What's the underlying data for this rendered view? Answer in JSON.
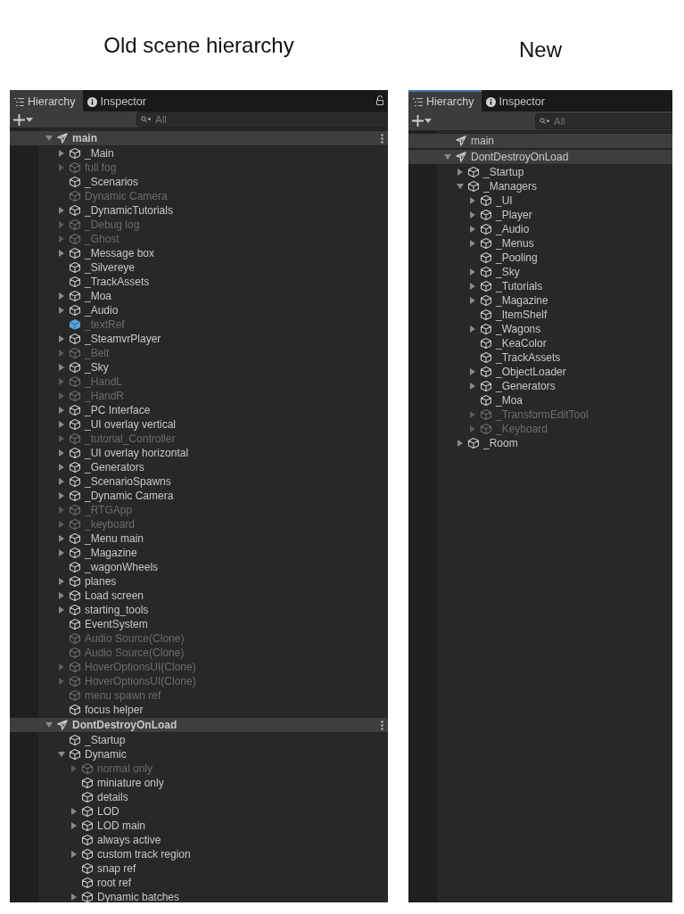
{
  "panels": [
    {
      "caption": "Old scene hierarchy",
      "focused": false,
      "show_lock": true,
      "tabs": [
        {
          "label": "Hierarchy",
          "kind": "hierarchy",
          "selected": true
        },
        {
          "label": "Inspector",
          "kind": "inspector",
          "selected": false
        }
      ],
      "search": {
        "placeholder": "All"
      },
      "scenes": [
        {
          "name": "main",
          "has_children": true,
          "expanded": true,
          "menu": true,
          "children": [
            {
              "name": "_Main",
              "kind": "object",
              "active": true,
              "has_children": true,
              "expanded": false
            },
            {
              "name": "full fog",
              "kind": "object",
              "active": false,
              "has_children": true,
              "expanded": false
            },
            {
              "name": "_Scenarios",
              "kind": "object",
              "active": true,
              "has_children": false
            },
            {
              "name": "Dynamic Camera",
              "kind": "object",
              "active": false,
              "has_children": false
            },
            {
              "name": "_DynamicTutorials",
              "kind": "object",
              "active": true,
              "has_children": true,
              "expanded": false
            },
            {
              "name": "_Debug log",
              "kind": "object",
              "active": false,
              "has_children": true,
              "expanded": false
            },
            {
              "name": "_Ghost",
              "kind": "object",
              "active": false,
              "has_children": true,
              "expanded": false
            },
            {
              "name": "_Message box",
              "kind": "object",
              "active": true,
              "has_children": true,
              "expanded": false
            },
            {
              "name": "_Silvereye",
              "kind": "object",
              "active": true,
              "has_children": false
            },
            {
              "name": "_TrackAssets",
              "kind": "object",
              "active": true,
              "has_children": false
            },
            {
              "name": "_Moa",
              "kind": "object",
              "active": true,
              "has_children": true,
              "expanded": false
            },
            {
              "name": "_Audio",
              "kind": "object",
              "active": true,
              "has_children": true,
              "expanded": false
            },
            {
              "name": "_textRef",
              "kind": "prefab",
              "active": false,
              "has_children": false
            },
            {
              "name": "_SteamvrPlayer",
              "kind": "object",
              "active": true,
              "has_children": true,
              "expanded": false
            },
            {
              "name": "_Belt",
              "kind": "object",
              "active": false,
              "has_children": true,
              "expanded": false
            },
            {
              "name": "_Sky",
              "kind": "object",
              "active": true,
              "has_children": true,
              "expanded": false
            },
            {
              "name": "_HandL",
              "kind": "object",
              "active": false,
              "has_children": true,
              "expanded": false
            },
            {
              "name": "_HandR",
              "kind": "object",
              "active": false,
              "has_children": true,
              "expanded": false
            },
            {
              "name": "_PC Interface",
              "kind": "object",
              "active": true,
              "has_children": true,
              "expanded": false
            },
            {
              "name": "_UI overlay vertical",
              "kind": "object",
              "active": true,
              "has_children": true,
              "expanded": false
            },
            {
              "name": "_tutorial_Controller",
              "kind": "object",
              "active": false,
              "has_children": true,
              "expanded": false
            },
            {
              "name": "_UI overlay horizontal",
              "kind": "object",
              "active": true,
              "has_children": true,
              "expanded": false
            },
            {
              "name": "_Generators",
              "kind": "object",
              "active": true,
              "has_children": true,
              "expanded": false
            },
            {
              "name": "_ScenarioSpawns",
              "kind": "object",
              "active": true,
              "has_children": true,
              "expanded": false
            },
            {
              "name": "_Dynamic Camera",
              "kind": "object",
              "active": true,
              "has_children": true,
              "expanded": false
            },
            {
              "name": "_RTGApp",
              "kind": "object",
              "active": false,
              "has_children": true,
              "expanded": false
            },
            {
              "name": "_keyboard",
              "kind": "object",
              "active": false,
              "has_children": true,
              "expanded": false
            },
            {
              "name": "_Menu main",
              "kind": "object",
              "active": true,
              "has_children": true,
              "expanded": false
            },
            {
              "name": "_Magazine",
              "kind": "object",
              "active": true,
              "has_children": true,
              "expanded": false
            },
            {
              "name": "_wagonWheels",
              "kind": "object",
              "active": true,
              "has_children": false
            },
            {
              "name": "planes",
              "kind": "object",
              "active": true,
              "has_children": true,
              "expanded": false
            },
            {
              "name": "Load screen",
              "kind": "object",
              "active": true,
              "has_children": true,
              "expanded": false
            },
            {
              "name": "starting_tools",
              "kind": "object",
              "active": true,
              "has_children": true,
              "expanded": false
            },
            {
              "name": "EventSystem",
              "kind": "object",
              "active": true,
              "has_children": false
            },
            {
              "name": "Audio Source(Clone)",
              "kind": "object",
              "active": false,
              "has_children": false
            },
            {
              "name": "Audio Source(Clone)",
              "kind": "object",
              "active": false,
              "has_children": false
            },
            {
              "name": "HoverOptionsUI(Clone)",
              "kind": "object",
              "active": false,
              "has_children": true,
              "expanded": false
            },
            {
              "name": "HoverOptionsUI(Clone)",
              "kind": "object",
              "active": false,
              "has_children": true,
              "expanded": false
            },
            {
              "name": "menu spawn ref",
              "kind": "object",
              "active": false,
              "has_children": false
            },
            {
              "name": "focus helper",
              "kind": "object",
              "active": true,
              "has_children": false
            }
          ]
        },
        {
          "name": "DontDestroyOnLoad",
          "has_children": true,
          "expanded": true,
          "menu": true,
          "children": [
            {
              "name": "_Startup",
              "kind": "object",
              "active": true,
              "has_children": false
            },
            {
              "name": "Dynamic",
              "kind": "object",
              "active": true,
              "has_children": true,
              "expanded": true,
              "children": [
                {
                  "name": "normal only",
                  "kind": "object",
                  "active": false,
                  "has_children": true,
                  "expanded": false
                },
                {
                  "name": "miniature only",
                  "kind": "object",
                  "active": true,
                  "has_children": false
                },
                {
                  "name": "details",
                  "kind": "object",
                  "active": true,
                  "has_children": false
                },
                {
                  "name": "LOD",
                  "kind": "object",
                  "active": true,
                  "has_children": true,
                  "expanded": false
                },
                {
                  "name": "LOD main",
                  "kind": "object",
                  "active": true,
                  "has_children": true,
                  "expanded": false
                },
                {
                  "name": "always active",
                  "kind": "object",
                  "active": true,
                  "has_children": false
                },
                {
                  "name": "custom track region",
                  "kind": "object",
                  "active": true,
                  "has_children": true,
                  "expanded": false
                },
                {
                  "name": "snap ref",
                  "kind": "object",
                  "active": true,
                  "has_children": false
                },
                {
                  "name": "root ref",
                  "kind": "object",
                  "active": true,
                  "has_children": false
                },
                {
                  "name": "Dynamic batches",
                  "kind": "object",
                  "active": true,
                  "has_children": true,
                  "expanded": false
                }
              ]
            }
          ]
        }
      ]
    },
    {
      "caption": "New",
      "focused": true,
      "show_lock": false,
      "tabs": [
        {
          "label": "Hierarchy",
          "kind": "hierarchy",
          "selected": true
        },
        {
          "label": "Inspector",
          "kind": "inspector",
          "selected": false
        }
      ],
      "search": {
        "placeholder": "All"
      },
      "scenes": [
        {
          "name": "main",
          "has_children": false,
          "menu": false
        },
        {
          "name": "DontDestroyOnLoad",
          "has_children": true,
          "expanded": true,
          "menu": false,
          "children": [
            {
              "name": "_Startup",
              "kind": "object",
              "active": true,
              "has_children": true,
              "expanded": false
            },
            {
              "name": "_Managers",
              "kind": "object",
              "active": true,
              "has_children": true,
              "expanded": true,
              "children": [
                {
                  "name": "_UI",
                  "kind": "object",
                  "active": true,
                  "has_children": true,
                  "expanded": false
                },
                {
                  "name": "_Player",
                  "kind": "object",
                  "active": true,
                  "has_children": true,
                  "expanded": false
                },
                {
                  "name": "_Audio",
                  "kind": "object",
                  "active": true,
                  "has_children": true,
                  "expanded": false
                },
                {
                  "name": "_Menus",
                  "kind": "object",
                  "active": true,
                  "has_children": true,
                  "expanded": false
                },
                {
                  "name": "_Pooling",
                  "kind": "object",
                  "active": true,
                  "has_children": false
                },
                {
                  "name": "_Sky",
                  "kind": "object",
                  "active": true,
                  "has_children": true,
                  "expanded": false
                },
                {
                  "name": "_Tutorials",
                  "kind": "object",
                  "active": true,
                  "has_children": true,
                  "expanded": false
                },
                {
                  "name": "_Magazine",
                  "kind": "object",
                  "active": true,
                  "has_children": true,
                  "expanded": false
                },
                {
                  "name": "_ItemShelf",
                  "kind": "object",
                  "active": true,
                  "has_children": false
                },
                {
                  "name": "_Wagons",
                  "kind": "object",
                  "active": true,
                  "has_children": true,
                  "expanded": false
                },
                {
                  "name": "_KeaColor",
                  "kind": "object",
                  "active": true,
                  "has_children": false
                },
                {
                  "name": "_TrackAssets",
                  "kind": "object",
                  "active": true,
                  "has_children": false
                },
                {
                  "name": "_ObjectLoader",
                  "kind": "object",
                  "active": true,
                  "has_children": true,
                  "expanded": false
                },
                {
                  "name": "_Generators",
                  "kind": "object",
                  "active": true,
                  "has_children": true,
                  "expanded": false
                },
                {
                  "name": "_Moa",
                  "kind": "object",
                  "active": true,
                  "has_children": false
                },
                {
                  "name": "_TransformEditTool",
                  "kind": "object",
                  "active": false,
                  "has_children": true,
                  "expanded": false
                },
                {
                  "name": "_Keyboard",
                  "kind": "object",
                  "active": false,
                  "has_children": true,
                  "expanded": false
                }
              ]
            },
            {
              "name": "_Room",
              "kind": "object",
              "active": true,
              "has_children": true,
              "expanded": false
            }
          ]
        }
      ]
    }
  ]
}
